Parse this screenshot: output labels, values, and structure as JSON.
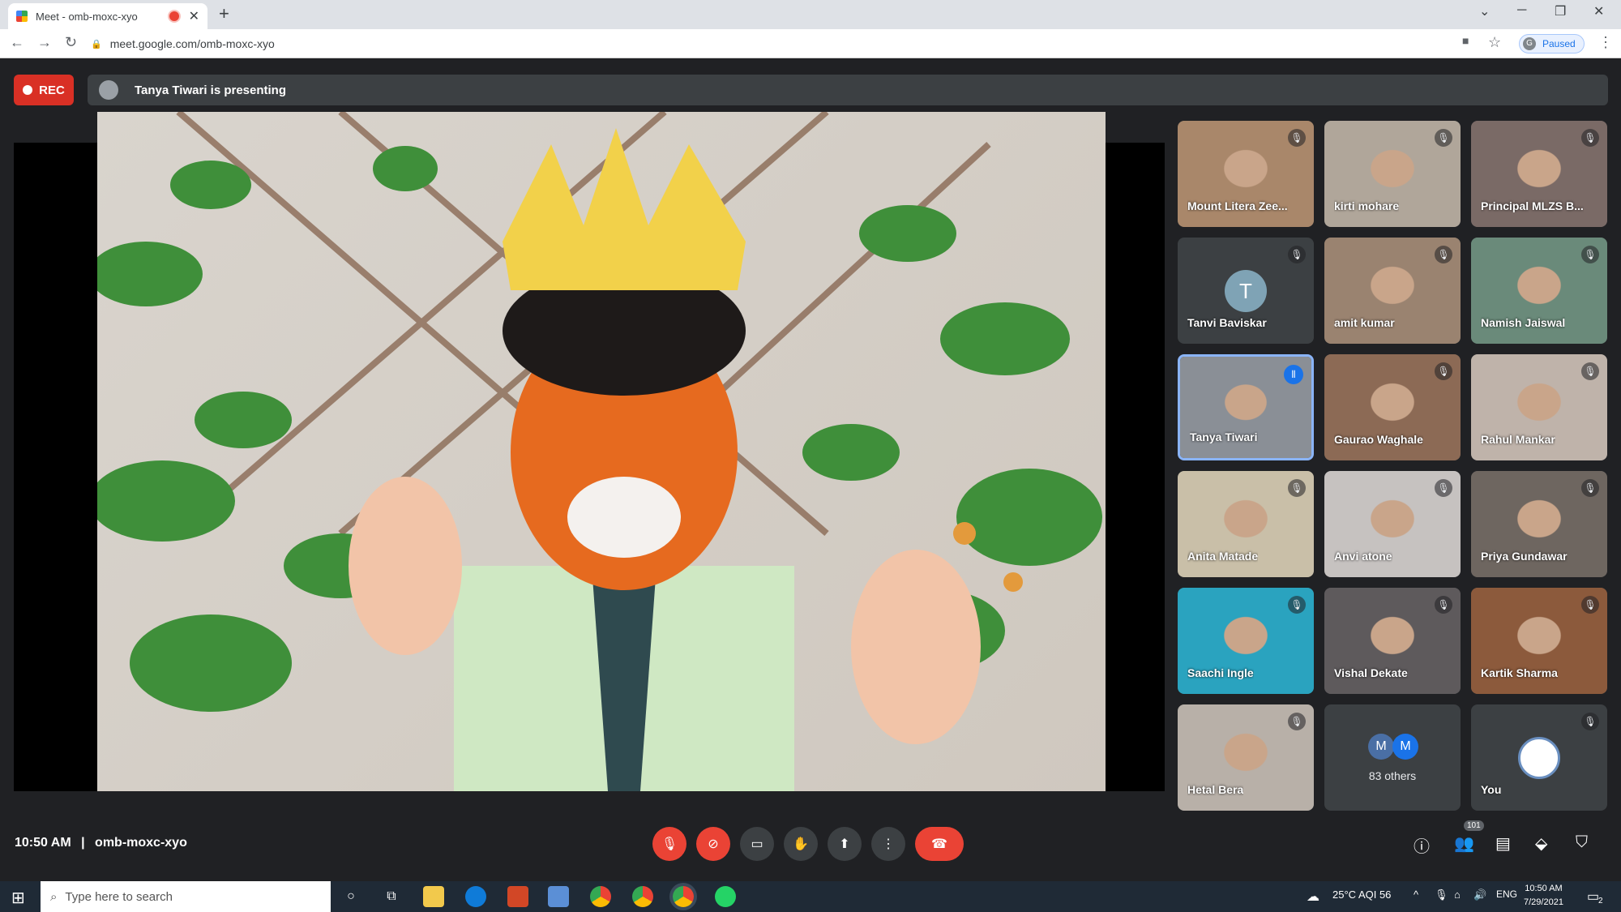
{
  "browser": {
    "tab_title": "Meet - omb-moxc-xyo",
    "url": "meet.google.com/omb-moxc-xyo",
    "profile_status": "Paused",
    "profile_initial": "G"
  },
  "meeting": {
    "rec_label": "REC",
    "presenting_text": "Tanya Tiwari is presenting",
    "time": "10:50 AM",
    "separator": "|",
    "code": "omb-moxc-xyo",
    "participant_count": "101"
  },
  "participants": [
    {
      "name": "Mount Litera Zee...",
      "muted": true,
      "bg": "#a9876a"
    },
    {
      "name": "kirti mohare",
      "muted": true,
      "bg": "#b0a69a"
    },
    {
      "name": "Principal MLZS B...",
      "muted": true,
      "bg": "#7a6a66"
    },
    {
      "name": "Tanvi Baviskar",
      "muted": true,
      "initial": "T"
    },
    {
      "name": "amit kumar",
      "muted": true,
      "bg": "#9a8370"
    },
    {
      "name": "Namish Jaiswal",
      "muted": true,
      "bg": "#6a8a7a"
    },
    {
      "name": "Tanya Tiwari",
      "speaking": true,
      "bg": "#8a8f96"
    },
    {
      "name": "Gaurao Waghale",
      "muted": true,
      "bg": "#8c6a55"
    },
    {
      "name": "Rahul Mankar",
      "muted": true,
      "bg": "#bfb3aa"
    },
    {
      "name": "Anita Matade",
      "muted": true,
      "bg": "#c9bfa8"
    },
    {
      "name": "Anvi atone",
      "muted": true,
      "bg": "#c6c2c0"
    },
    {
      "name": "Priya Gundawar",
      "muted": true,
      "bg": "#6e6660"
    },
    {
      "name": "Saachi Ingle",
      "muted": true,
      "bg": "#2aa3bf"
    },
    {
      "name": "Vishal Dekate",
      "muted": true,
      "bg": "#5e5a5c"
    },
    {
      "name": "Kartik Sharma",
      "muted": true,
      "bg": "#8c5a3c"
    },
    {
      "name": "Hetal Bera",
      "muted": true,
      "bg": "#b8b0a8"
    }
  ],
  "others": {
    "label": "83 others",
    "avatars": [
      "M",
      "M"
    ]
  },
  "you": {
    "label": "You",
    "muted": true
  },
  "taskbar": {
    "search_placeholder": "Type here to search",
    "weather": "25°C  AQI 56",
    "lang": "ENG",
    "time": "10:50 AM",
    "date": "7/29/2021",
    "notifications": "2"
  }
}
